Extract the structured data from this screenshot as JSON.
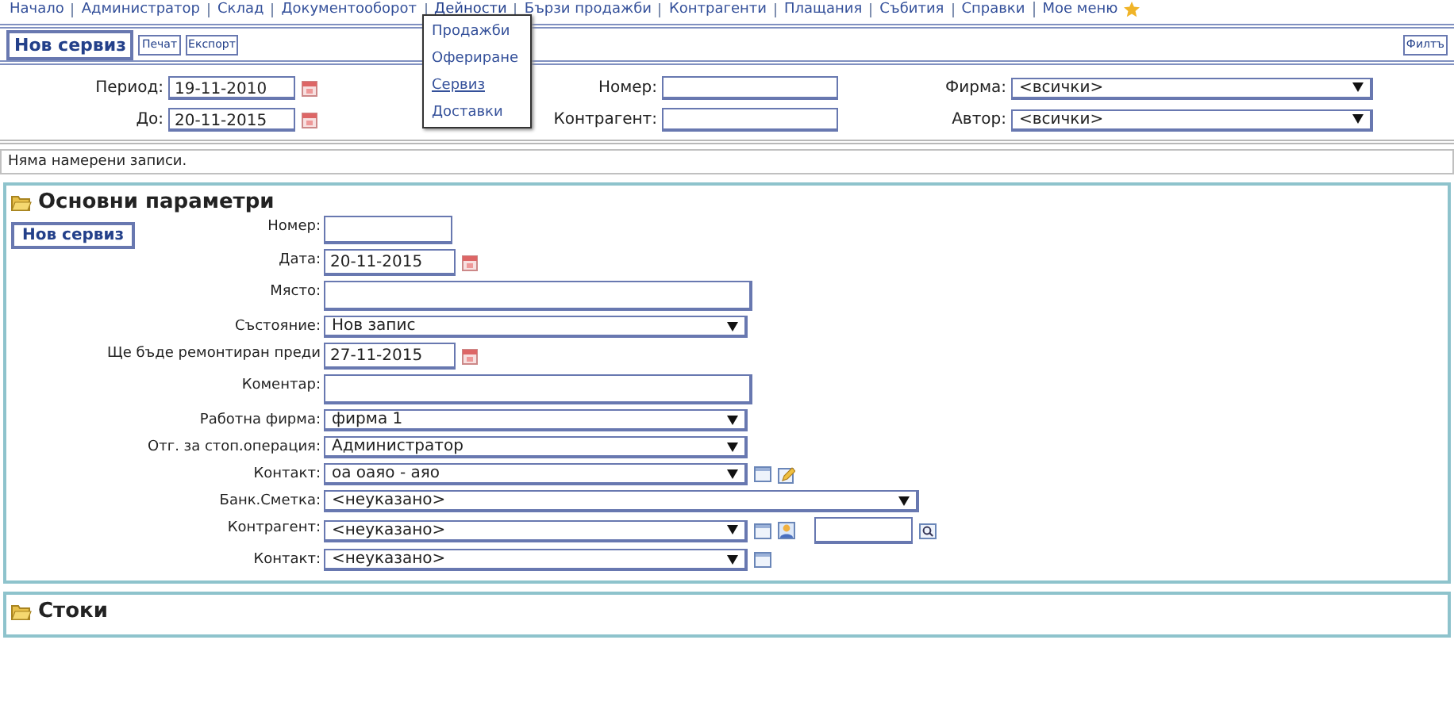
{
  "menu": [
    {
      "label": "Начало",
      "open": false
    },
    {
      "label": "Администратор",
      "open": false
    },
    {
      "label": "Склад",
      "open": false
    },
    {
      "label": "Документооборот",
      "open": false
    },
    {
      "label": "Дейности",
      "open": true
    },
    {
      "label": "Бързи продажби",
      "open": false
    },
    {
      "label": "Контрагенти",
      "open": false
    },
    {
      "label": "Плащания",
      "open": false
    },
    {
      "label": "Събития",
      "open": false
    },
    {
      "label": "Справки",
      "open": false
    },
    {
      "label": "Мое меню",
      "open": false
    }
  ],
  "dropdown": [
    {
      "label": "Продажби",
      "selected": false
    },
    {
      "label": "Офериране",
      "selected": false
    },
    {
      "label": "Сервиз",
      "selected": true
    },
    {
      "label": "Доставки",
      "selected": false
    }
  ],
  "toolbar": {
    "buttons": [
      {
        "label": "Нов сервиз",
        "kind": "primary"
      },
      {
        "label": "Печат",
        "kind": "small"
      },
      {
        "label": "Експорт",
        "kind": "small"
      }
    ],
    "filter_button": "Филтъ"
  },
  "filter": [
    {
      "label": "Период:",
      "value": "19-11-2010",
      "kind": "date"
    },
    {
      "label": "Номер:",
      "kind": "text"
    },
    {
      "label": "Фирма:",
      "value": "<всички>",
      "kind": "select"
    },
    {
      "label": "До:",
      "value": "20-11-2015",
      "kind": "date"
    },
    {
      "label": "Контрагент:",
      "kind": "text"
    },
    {
      "label": "Автор:",
      "value": "<всички>",
      "kind": "select"
    }
  ],
  "message": "Няма намерени записи.",
  "sections": [
    {
      "title": "Основни параметри",
      "tab": "Нов сервиз",
      "fields": [
        {
          "label": "Номер:",
          "kind": "short"
        },
        {
          "label": "Дата:",
          "value": "20-11-2015",
          "kind": "date"
        },
        {
          "label": "Място:",
          "kind": "textarea"
        },
        {
          "label": "Състояние:",
          "value": "Нов запис",
          "kind": "select"
        },
        {
          "label": "Ще бъде ремонтиран преди",
          "value": "27-11-2015",
          "kind": "date"
        },
        {
          "label": "Коментар:",
          "kind": "textarea"
        },
        {
          "label": "Работна фирма:",
          "value": "фирма 1",
          "kind": "select"
        },
        {
          "label": "Отг. за стоп.операция:",
          "value": "Администратор",
          "kind": "select"
        },
        {
          "label": "Контакт:",
          "value": "оа оаяо - аяо",
          "kind": "select-edit"
        },
        {
          "label": "Банк.Сметка:",
          "value": "<неуказано>",
          "kind": "select-wide"
        },
        {
          "label": "Контрагент:",
          "value": "<неуказано>",
          "kind": "select-lookup"
        },
        {
          "label": "Контакт:",
          "value": "<неуказано>",
          "kind": "select-card"
        }
      ]
    },
    {
      "title": "Стоки"
    }
  ]
}
